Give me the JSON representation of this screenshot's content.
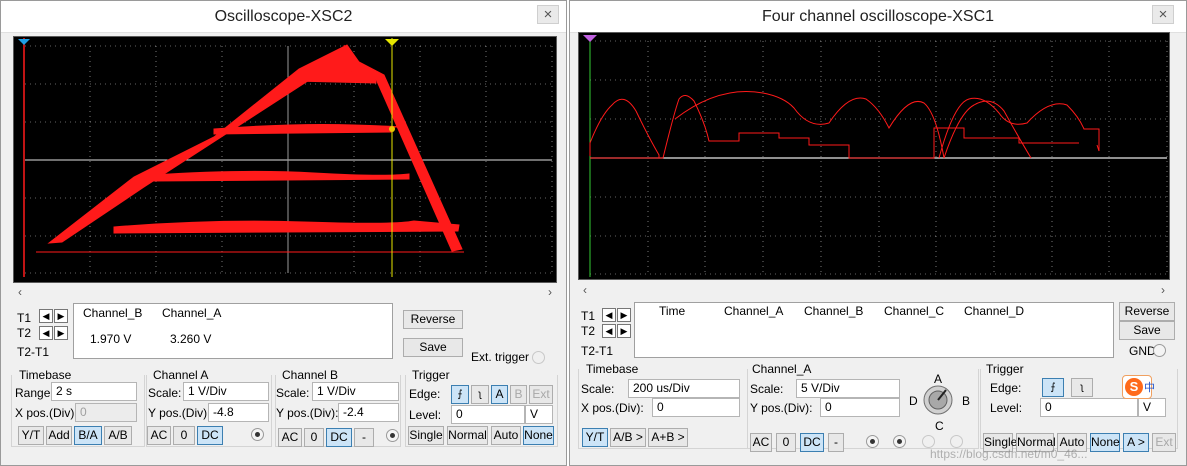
{
  "xsc2": {
    "title": "Oscilloscope-XSC2",
    "close": "×",
    "cursor_labels": [
      "1",
      "2"
    ],
    "readout": {
      "t1": "T1",
      "t2": "T2",
      "t2t1": "T2-T1",
      "ch_b_header": "Channel_B",
      "ch_a_header": "Channel_A",
      "ch_b_value": "1.970 V",
      "ch_a_value": "3.260 V"
    },
    "reverse": "Reverse",
    "save": "Save",
    "ext_trigger": "Ext. trigger",
    "timebase": {
      "title": "Timebase",
      "range_label": "Range:",
      "range_value": "2 s",
      "xpos_label": "X pos.(Div):",
      "xpos_value": "0",
      "buttons": [
        "Y/T",
        "Add",
        "B/A",
        "A/B"
      ],
      "active": "B/A"
    },
    "channel_a": {
      "title": "Channel A",
      "scale_label": "Scale:",
      "scale_value": "1 V/Div",
      "ypos_label": "Y pos.(Div):",
      "ypos_value": "-4.8",
      "buttons": [
        "AC",
        "0",
        "DC"
      ],
      "active": "DC"
    },
    "channel_b": {
      "title": "Channel B",
      "scale_label": "Scale:",
      "scale_value": "1 V/Div",
      "ypos_label": "Y pos.(Div):",
      "ypos_value": "-2.4",
      "buttons": [
        "AC",
        "0",
        "DC",
        "-"
      ],
      "active": "DC"
    },
    "trigger": {
      "title": "Trigger",
      "edge_label": "Edge:",
      "edge_buttons": [
        "A",
        "B",
        "Ext"
      ],
      "level_label": "Level:",
      "level_value": "0",
      "level_unit": "V",
      "mode_buttons": [
        "Single",
        "Normal",
        "Auto",
        "None"
      ],
      "active": "None"
    }
  },
  "xsc1": {
    "title": "Four channel oscilloscope-XSC1",
    "close": "×",
    "readout": {
      "t1": "T1",
      "t2": "T2",
      "t2t1": "T2-T1",
      "headers": [
        "Time",
        "Channel_A",
        "Channel_B",
        "Channel_C",
        "Channel_D"
      ]
    },
    "reverse": "Reverse",
    "save": "Save",
    "gnd": "GND",
    "timebase": {
      "title": "Timebase",
      "scale_label": "Scale:",
      "scale_value": "200 us/Div",
      "xpos_label": "X pos.(Div):",
      "xpos_value": "0",
      "buttons": [
        "Y/T",
        "A/B >",
        "A+B >"
      ],
      "active": "Y/T"
    },
    "channel": {
      "title": "Channel_A",
      "scale_label": "Scale:",
      "scale_value": "5 V/Div",
      "ypos_label": "Y pos.(Div):",
      "ypos_value": "0",
      "buttons": [
        "AC",
        "0",
        "DC",
        "-"
      ],
      "active": "DC",
      "knob_labels": [
        "A",
        "B",
        "C",
        "D"
      ]
    },
    "trigger": {
      "title": "Trigger",
      "edge_label": "Edge:",
      "level_label": "Level:",
      "level_value": "0",
      "level_unit": "V",
      "mode_buttons": [
        "Single",
        "Normal",
        "Auto",
        "None",
        "A >",
        "Ext"
      ],
      "active": [
        "None",
        "A >"
      ]
    }
  },
  "watermark": "https://blog.csdn.net/m0_46...",
  "ime_badge": "中",
  "colors": {
    "trace": "#ff1a1a",
    "grid": "#c8c8c8",
    "screen": "#000000",
    "cursor1": "#1ea0e6",
    "cursor2": "#e8e800"
  }
}
